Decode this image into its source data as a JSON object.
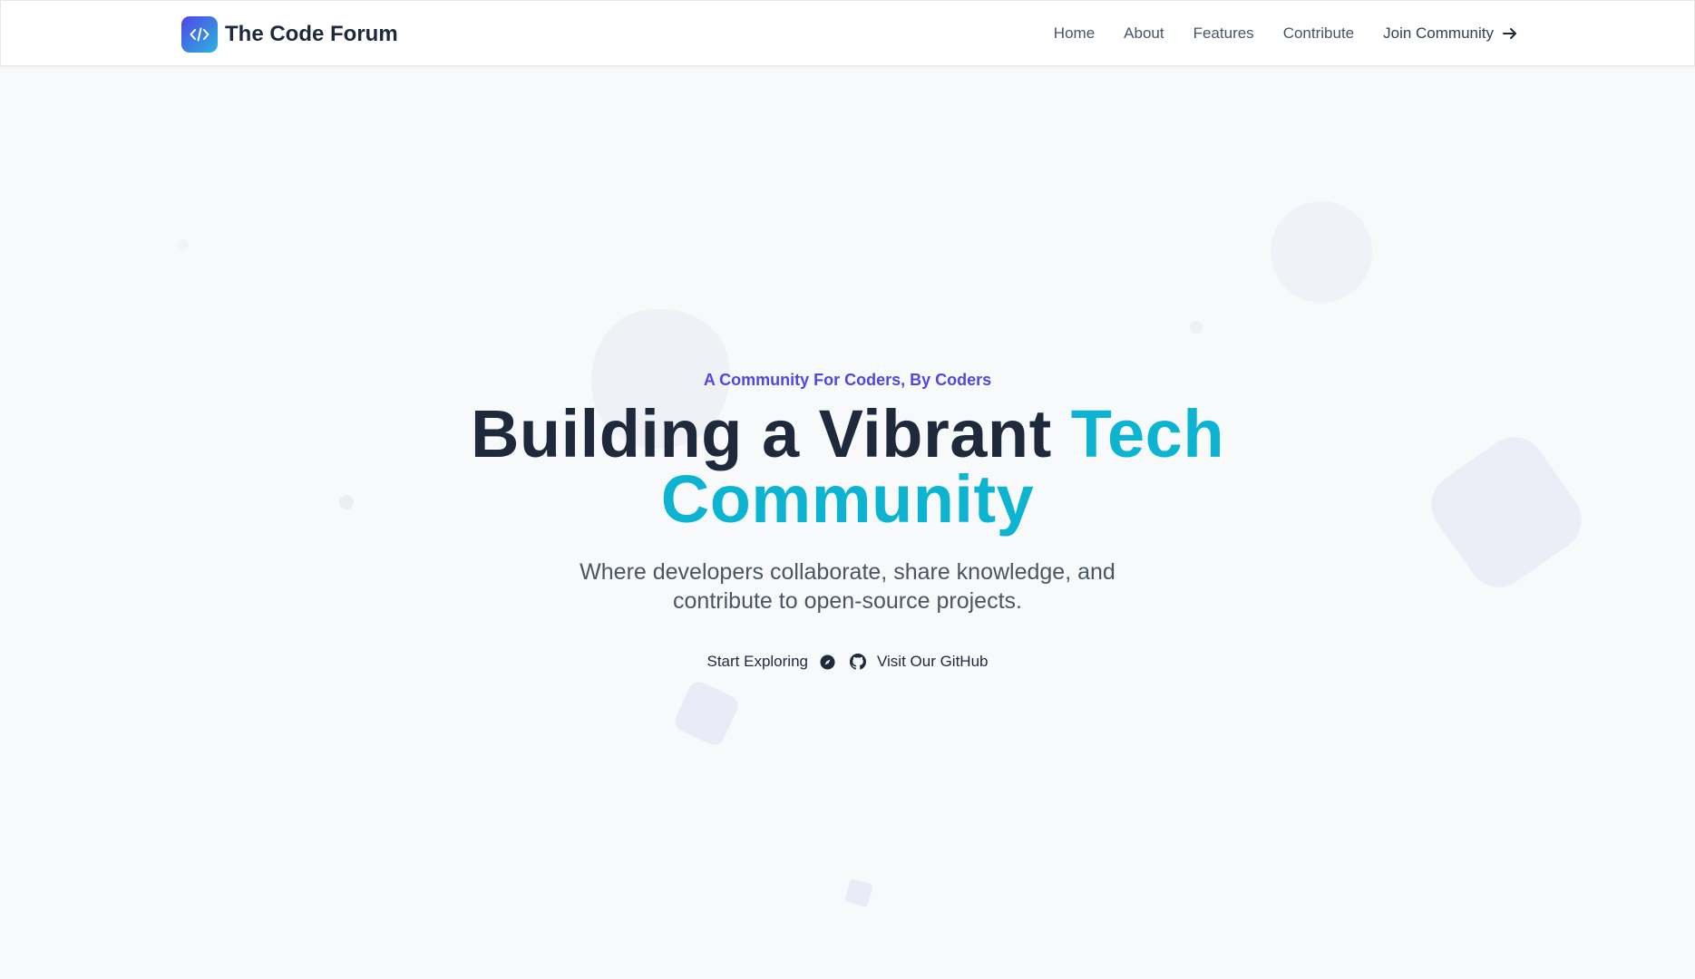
{
  "brand": {
    "name": "The Code Forum",
    "logo_icon": "code-icon",
    "logo_gradient": [
      "#4f46e5",
      "#2bb4e0"
    ]
  },
  "nav": {
    "items": [
      {
        "label": "Home"
      },
      {
        "label": "About"
      },
      {
        "label": "Features"
      },
      {
        "label": "Contribute"
      }
    ],
    "join_label": "Join Community",
    "join_icon": "arrow-right-icon"
  },
  "hero": {
    "eyebrow": "A Community For Coders, By Coders",
    "headline_main": "Building a Vibrant ",
    "headline_accent_1": "Tech",
    "headline_accent_2": "Community",
    "subtitle_line1": "Where developers collaborate, share knowledge, and",
    "subtitle_line2": "contribute to open-source projects.",
    "cta_primary": "Start Exploring",
    "cta_primary_icon": "compass-icon",
    "cta_secondary": "Visit Our GitHub",
    "cta_secondary_icon": "github-icon"
  },
  "colors": {
    "accent": "#0cb4d2",
    "eyebrow": "#4f46e5",
    "heading": "#1e293b",
    "background": "#f8f9fb"
  }
}
